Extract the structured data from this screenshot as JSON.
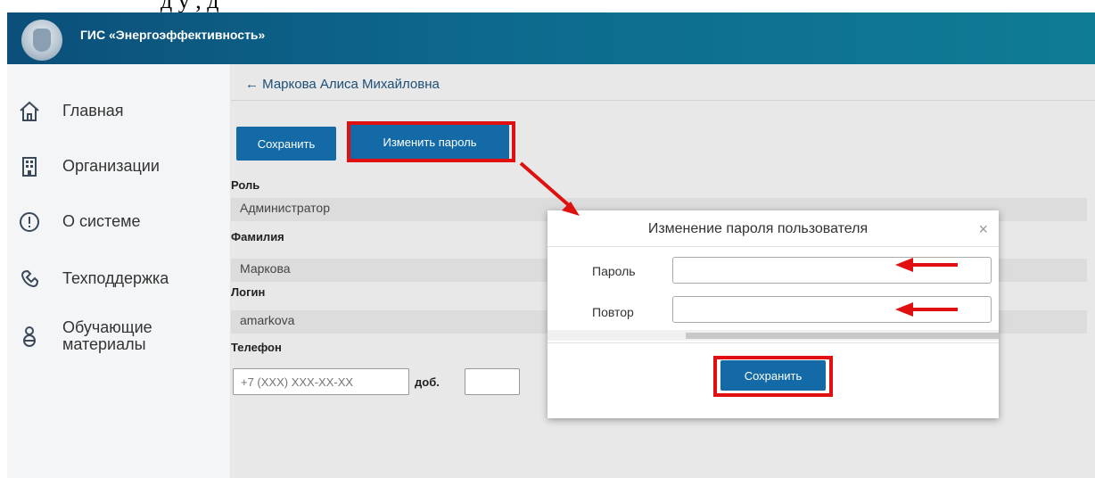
{
  "header": {
    "app_title": "ГИС «Энергоэффективность»",
    "top_cut_text": "д       у       ,           д"
  },
  "sidebar": {
    "items": [
      {
        "label": "Главная",
        "icon": "home-icon"
      },
      {
        "label": "Организации",
        "icon": "building-icon"
      },
      {
        "label": "О системе",
        "icon": "info-icon"
      },
      {
        "label": "Техподдержка",
        "icon": "support-icon"
      },
      {
        "label_line1": "Обучающие",
        "label_line2": "материалы",
        "icon": "learning-icon"
      }
    ]
  },
  "main": {
    "breadcrumb": "← Маркова Алиса Михайловна",
    "buttons": {
      "save": "Сохранить",
      "change_password": "Изменить пароль"
    },
    "fields": [
      {
        "label": "Роль",
        "value": "Администратор"
      },
      {
        "label": "Фамилия",
        "value": "Маркова"
      },
      {
        "label": "Логин",
        "value": "amarkova"
      }
    ],
    "phone": {
      "label": "Телефон",
      "placeholder": "+7 (XXX) XXX-XX-XX",
      "ext_label": "доб."
    }
  },
  "modal": {
    "title": "Изменение пароля пользователя",
    "close": "×",
    "password_label": "Пароль",
    "repeat_label": "Повтор",
    "save_button": "Сохранить"
  },
  "colors": {
    "accent": "#136aa6",
    "highlight": "#e01010",
    "header": "#0b4f7a"
  }
}
